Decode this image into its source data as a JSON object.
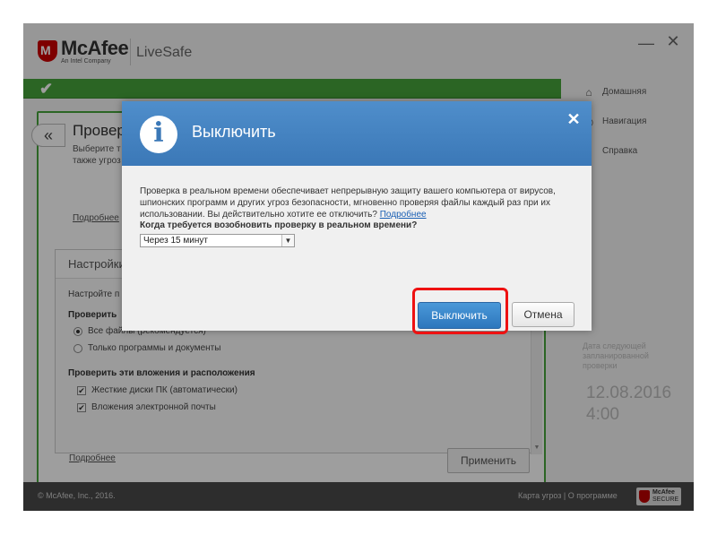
{
  "app": {
    "brand": "McAfee",
    "brand_sub": "An Intel Company",
    "product": "LiveSafe",
    "minimize": "—",
    "close": "✕"
  },
  "panel": {
    "back": "«",
    "title": "Провер",
    "desc_line1": "Выберите т",
    "desc_line2": "также угроз",
    "more1": "Подробнее",
    "settings_title": "Настройки",
    "settings_intro": "Настройте п",
    "check_heading": "Проверить",
    "radio_all": "Все файлы (рекомендуется)",
    "radio_programs": "Только программы и документы",
    "locations_heading": "Проверить эти вложения и расположения",
    "cb_disks": "Жесткие диски ПК (автоматически)",
    "cb_email": "Вложения электронной почты",
    "more2": "Подробнее",
    "apply": "Применить"
  },
  "nav": {
    "home": "Домашняя",
    "navigation": "Навигация",
    "help": "Справка"
  },
  "schedule": {
    "label": "Дата следующей запланированной проверки",
    "date": "12.08.2016",
    "time": "4:00"
  },
  "footer": {
    "copyright": "© McAfee, Inc., 2016.",
    "links": "Карта угроз  |  О программе",
    "badge_1": "McAfee",
    "badge_2": "SECURE"
  },
  "dialog": {
    "title": "Выключить",
    "close": "✕",
    "text": "Проверка в реальном времени обеспечивает непрерывную защиту вашего компьютера от вирусов, шпионских программ и других угроз безопасности, мгновенно проверяя файлы каждый раз при их использовании. Вы действительно хотите ее отключить? ",
    "link": "Подробнее",
    "question": "Когда требуется возобновить проверку в реальном времени?",
    "select_value": "Через 15 минут",
    "select_arrow": "▼",
    "btn_off": "Выключить",
    "btn_cancel": "Отмена"
  },
  "icons": {
    "check": "✔",
    "home": "⌂",
    "nav": "◉",
    "help": "?"
  },
  "colors": {
    "accent_green": "#46a33a",
    "dialog_blue": "#3b78b7",
    "highlight_red": "#ee1111"
  }
}
